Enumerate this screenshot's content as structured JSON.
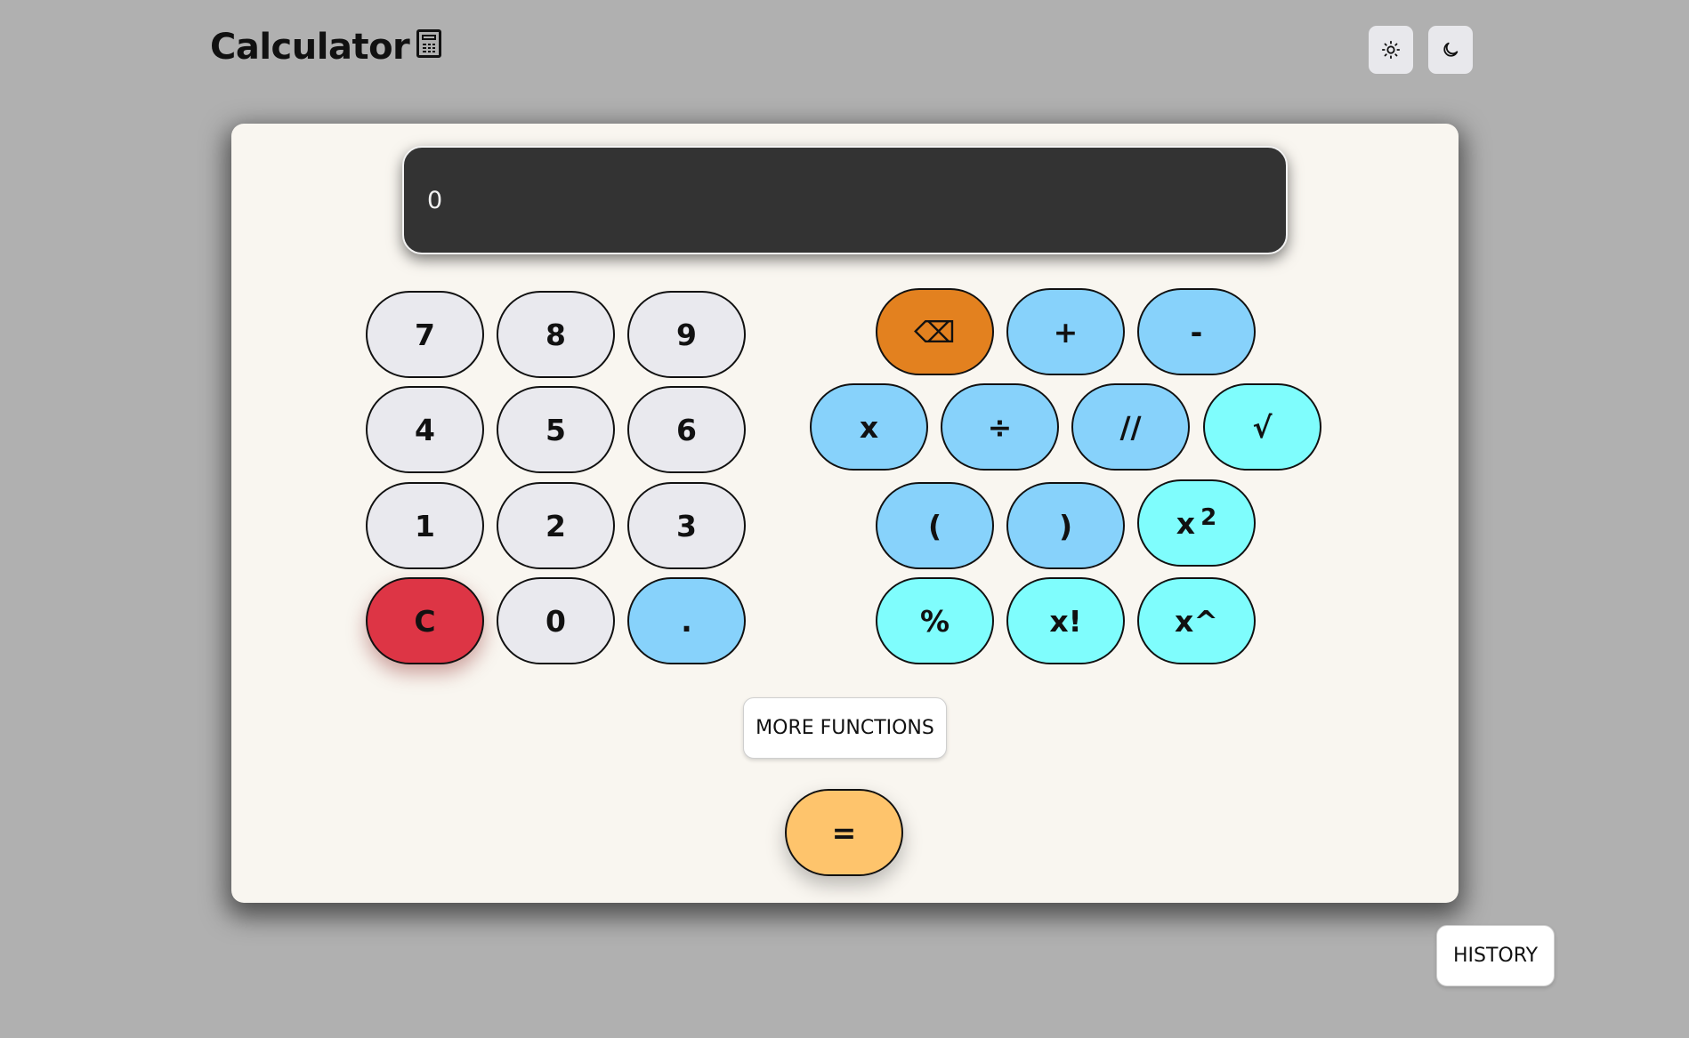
{
  "header": {
    "title": "Calculator",
    "icons": [
      "calculator-icon"
    ]
  },
  "theme": {
    "light_icon": "sun-icon",
    "dark_icon": "moon-icon"
  },
  "display": {
    "value": "0"
  },
  "number_keys": {
    "k7": "7",
    "k8": "8",
    "k9": "9",
    "k4": "4",
    "k5": "5",
    "k6": "6",
    "k1": "1",
    "k2": "2",
    "k3": "3",
    "clear": "C",
    "k0": "0",
    "dot": "."
  },
  "operator_keys": {
    "backspace": "⌫",
    "plus": "+",
    "minus": "-",
    "multiply": "x",
    "divide": "÷",
    "floor_divide": "//",
    "sqrt": "√",
    "open_paren": "(",
    "close_paren": ")",
    "square_base": "x",
    "square_exp": "2",
    "percent": "%",
    "factorial": "x!",
    "power": "x^"
  },
  "equals": "=",
  "more_functions": "MORE FUNCTIONS",
  "history": "HISTORY",
  "colors": {
    "background": "#b0b0b0",
    "panel": "#f9f6f0",
    "display": "#333333",
    "number_key": "#e9e9ee",
    "operator_key": "#87d2fb",
    "function_key": "#7ffdfd",
    "clear_key": "#dd3545",
    "backspace_key": "#e3811f",
    "equals_key": "#fec46c"
  }
}
